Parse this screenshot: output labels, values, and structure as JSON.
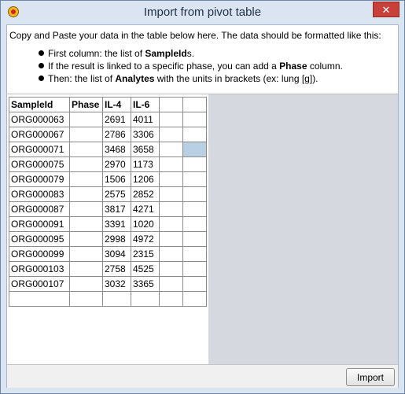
{
  "window": {
    "title": "Import from pivot table",
    "close_glyph": "✕"
  },
  "instructions": {
    "intro": "Copy and Paste your data in the table below here. The data should be formatted like this:",
    "bullets": [
      {
        "pre": "First column: the list of ",
        "bold": "SampleId",
        "post": "s."
      },
      {
        "pre": "If the result is linked to a specific phase, you can add a ",
        "bold": "Phase",
        "post": " column."
      },
      {
        "pre": "Then: the list of ",
        "bold": "Analytes",
        "post": " with the units in brackets (ex: lung [g])."
      }
    ]
  },
  "table": {
    "headers": [
      "SampleId",
      "Phase",
      "IL-4",
      "IL-6",
      "",
      ""
    ],
    "rows": [
      [
        "ORG000063",
        "",
        "2691",
        "4011",
        "",
        ""
      ],
      [
        "ORG000067",
        "",
        "2786",
        "3306",
        "",
        ""
      ],
      [
        "ORG000071",
        "",
        "3468",
        "3658",
        "",
        ""
      ],
      [
        "ORG000075",
        "",
        "2970",
        "1173",
        "",
        ""
      ],
      [
        "ORG000079",
        "",
        "1506",
        "1206",
        "",
        ""
      ],
      [
        "ORG000083",
        "",
        "2575",
        "2852",
        "",
        ""
      ],
      [
        "ORG000087",
        "",
        "3817",
        "4271",
        "",
        ""
      ],
      [
        "ORG000091",
        "",
        "3391",
        "1020",
        "",
        ""
      ],
      [
        "ORG000095",
        "",
        "2998",
        "4972",
        "",
        ""
      ],
      [
        "ORG000099",
        "",
        "3094",
        "2315",
        "",
        ""
      ],
      [
        "ORG000103",
        "",
        "2758",
        "4525",
        "",
        ""
      ],
      [
        "ORG000107",
        "",
        "3032",
        "3365",
        "",
        ""
      ],
      [
        "",
        "",
        "",
        "",
        "",
        ""
      ]
    ],
    "selected_cell": {
      "row": 2,
      "col": 5
    },
    "selection_color": "#b8cfe4"
  },
  "footer": {
    "import_label": "Import"
  }
}
